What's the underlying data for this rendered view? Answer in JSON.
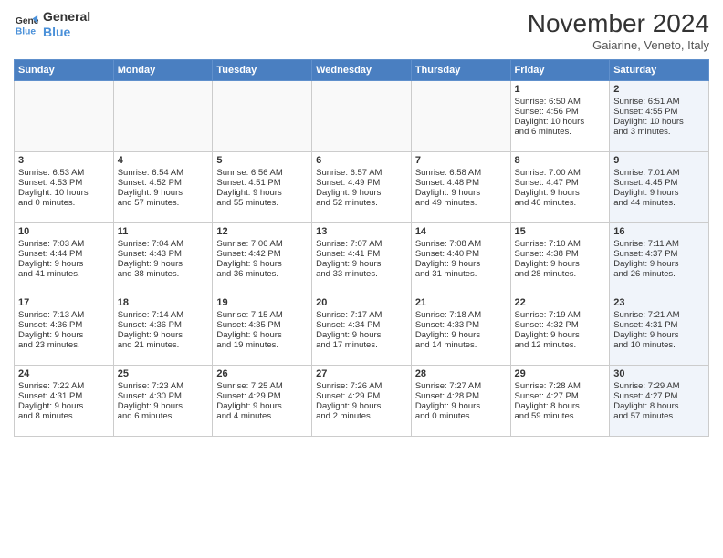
{
  "logo": {
    "line1": "General",
    "line2": "Blue"
  },
  "title": "November 2024",
  "subtitle": "Gaiarine, Veneto, Italy",
  "headers": [
    "Sunday",
    "Monday",
    "Tuesday",
    "Wednesday",
    "Thursday",
    "Friday",
    "Saturday"
  ],
  "weeks": [
    [
      {
        "day": "",
        "info": "",
        "type": "empty"
      },
      {
        "day": "",
        "info": "",
        "type": "empty"
      },
      {
        "day": "",
        "info": "",
        "type": "empty"
      },
      {
        "day": "",
        "info": "",
        "type": "empty"
      },
      {
        "day": "",
        "info": "",
        "type": "empty"
      },
      {
        "day": "1",
        "info": "Sunrise: 6:50 AM\nSunset: 4:56 PM\nDaylight: 10 hours\nand 6 minutes.",
        "type": "normal"
      },
      {
        "day": "2",
        "info": "Sunrise: 6:51 AM\nSunset: 4:55 PM\nDaylight: 10 hours\nand 3 minutes.",
        "type": "saturday"
      }
    ],
    [
      {
        "day": "3",
        "info": "Sunrise: 6:53 AM\nSunset: 4:53 PM\nDaylight: 10 hours\nand 0 minutes.",
        "type": "normal"
      },
      {
        "day": "4",
        "info": "Sunrise: 6:54 AM\nSunset: 4:52 PM\nDaylight: 9 hours\nand 57 minutes.",
        "type": "normal"
      },
      {
        "day": "5",
        "info": "Sunrise: 6:56 AM\nSunset: 4:51 PM\nDaylight: 9 hours\nand 55 minutes.",
        "type": "normal"
      },
      {
        "day": "6",
        "info": "Sunrise: 6:57 AM\nSunset: 4:49 PM\nDaylight: 9 hours\nand 52 minutes.",
        "type": "normal"
      },
      {
        "day": "7",
        "info": "Sunrise: 6:58 AM\nSunset: 4:48 PM\nDaylight: 9 hours\nand 49 minutes.",
        "type": "normal"
      },
      {
        "day": "8",
        "info": "Sunrise: 7:00 AM\nSunset: 4:47 PM\nDaylight: 9 hours\nand 46 minutes.",
        "type": "normal"
      },
      {
        "day": "9",
        "info": "Sunrise: 7:01 AM\nSunset: 4:45 PM\nDaylight: 9 hours\nand 44 minutes.",
        "type": "saturday"
      }
    ],
    [
      {
        "day": "10",
        "info": "Sunrise: 7:03 AM\nSunset: 4:44 PM\nDaylight: 9 hours\nand 41 minutes.",
        "type": "normal"
      },
      {
        "day": "11",
        "info": "Sunrise: 7:04 AM\nSunset: 4:43 PM\nDaylight: 9 hours\nand 38 minutes.",
        "type": "normal"
      },
      {
        "day": "12",
        "info": "Sunrise: 7:06 AM\nSunset: 4:42 PM\nDaylight: 9 hours\nand 36 minutes.",
        "type": "normal"
      },
      {
        "day": "13",
        "info": "Sunrise: 7:07 AM\nSunset: 4:41 PM\nDaylight: 9 hours\nand 33 minutes.",
        "type": "normal"
      },
      {
        "day": "14",
        "info": "Sunrise: 7:08 AM\nSunset: 4:40 PM\nDaylight: 9 hours\nand 31 minutes.",
        "type": "normal"
      },
      {
        "day": "15",
        "info": "Sunrise: 7:10 AM\nSunset: 4:38 PM\nDaylight: 9 hours\nand 28 minutes.",
        "type": "normal"
      },
      {
        "day": "16",
        "info": "Sunrise: 7:11 AM\nSunset: 4:37 PM\nDaylight: 9 hours\nand 26 minutes.",
        "type": "saturday"
      }
    ],
    [
      {
        "day": "17",
        "info": "Sunrise: 7:13 AM\nSunset: 4:36 PM\nDaylight: 9 hours\nand 23 minutes.",
        "type": "normal"
      },
      {
        "day": "18",
        "info": "Sunrise: 7:14 AM\nSunset: 4:36 PM\nDaylight: 9 hours\nand 21 minutes.",
        "type": "normal"
      },
      {
        "day": "19",
        "info": "Sunrise: 7:15 AM\nSunset: 4:35 PM\nDaylight: 9 hours\nand 19 minutes.",
        "type": "normal"
      },
      {
        "day": "20",
        "info": "Sunrise: 7:17 AM\nSunset: 4:34 PM\nDaylight: 9 hours\nand 17 minutes.",
        "type": "normal"
      },
      {
        "day": "21",
        "info": "Sunrise: 7:18 AM\nSunset: 4:33 PM\nDaylight: 9 hours\nand 14 minutes.",
        "type": "normal"
      },
      {
        "day": "22",
        "info": "Sunrise: 7:19 AM\nSunset: 4:32 PM\nDaylight: 9 hours\nand 12 minutes.",
        "type": "normal"
      },
      {
        "day": "23",
        "info": "Sunrise: 7:21 AM\nSunset: 4:31 PM\nDaylight: 9 hours\nand 10 minutes.",
        "type": "saturday"
      }
    ],
    [
      {
        "day": "24",
        "info": "Sunrise: 7:22 AM\nSunset: 4:31 PM\nDaylight: 9 hours\nand 8 minutes.",
        "type": "normal"
      },
      {
        "day": "25",
        "info": "Sunrise: 7:23 AM\nSunset: 4:30 PM\nDaylight: 9 hours\nand 6 minutes.",
        "type": "normal"
      },
      {
        "day": "26",
        "info": "Sunrise: 7:25 AM\nSunset: 4:29 PM\nDaylight: 9 hours\nand 4 minutes.",
        "type": "normal"
      },
      {
        "day": "27",
        "info": "Sunrise: 7:26 AM\nSunset: 4:29 PM\nDaylight: 9 hours\nand 2 minutes.",
        "type": "normal"
      },
      {
        "day": "28",
        "info": "Sunrise: 7:27 AM\nSunset: 4:28 PM\nDaylight: 9 hours\nand 0 minutes.",
        "type": "normal"
      },
      {
        "day": "29",
        "info": "Sunrise: 7:28 AM\nSunset: 4:27 PM\nDaylight: 8 hours\nand 59 minutes.",
        "type": "normal"
      },
      {
        "day": "30",
        "info": "Sunrise: 7:29 AM\nSunset: 4:27 PM\nDaylight: 8 hours\nand 57 minutes.",
        "type": "saturday"
      }
    ]
  ]
}
